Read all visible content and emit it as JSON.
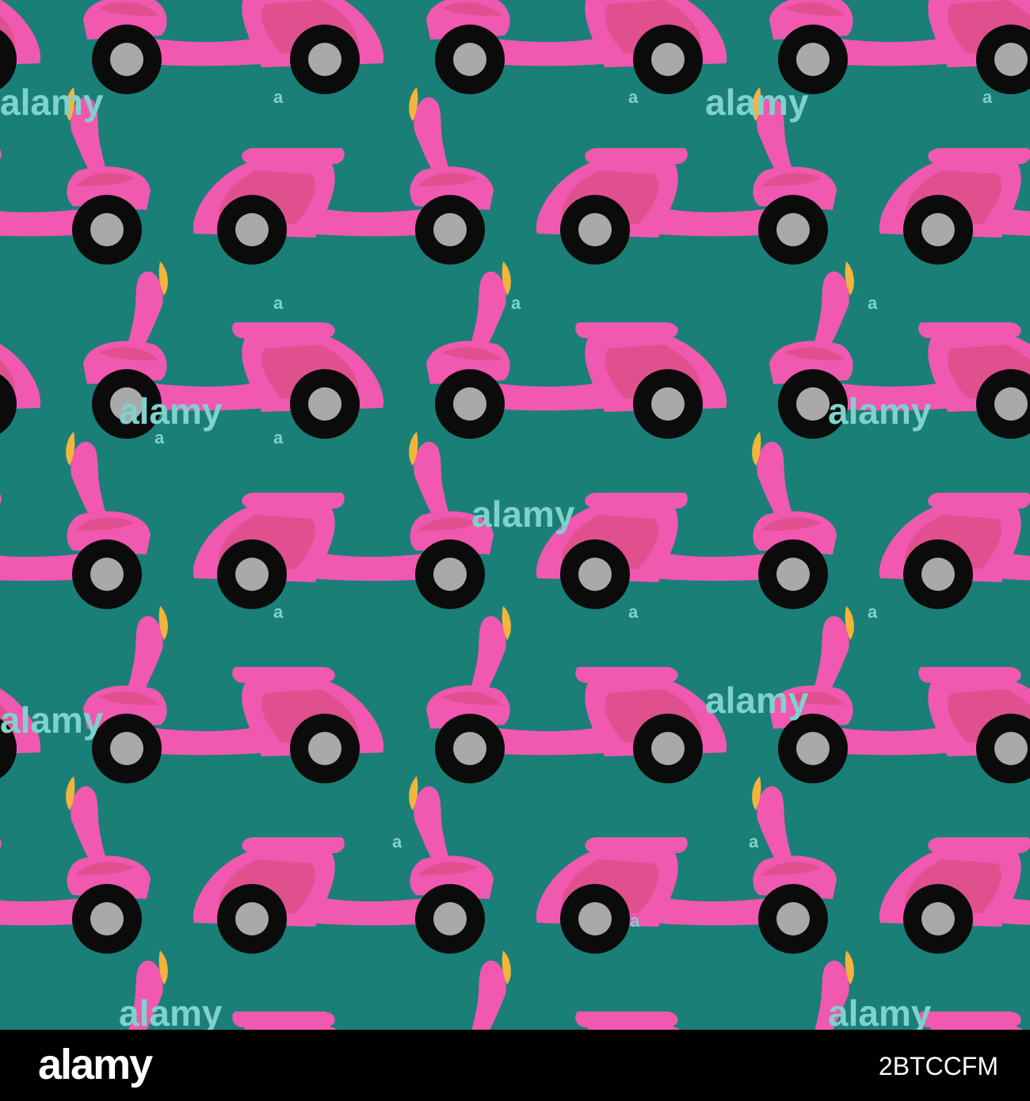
{
  "image": {
    "description_colors": {
      "background": "#1a7f77",
      "scooter_body": "#f158b0",
      "scooter_panel": "#e0508f",
      "wheel": "#0b0b0b",
      "hub": "#a9a9a9",
      "headlight": "#f2b43b",
      "watermark": "#7fd2cc"
    },
    "watermark_text": "alamy",
    "icons": [
      "scooter-icon",
      "watermark-icon"
    ]
  },
  "footer": {
    "logo_text": "alamy",
    "image_id": "2BTCCFM"
  }
}
